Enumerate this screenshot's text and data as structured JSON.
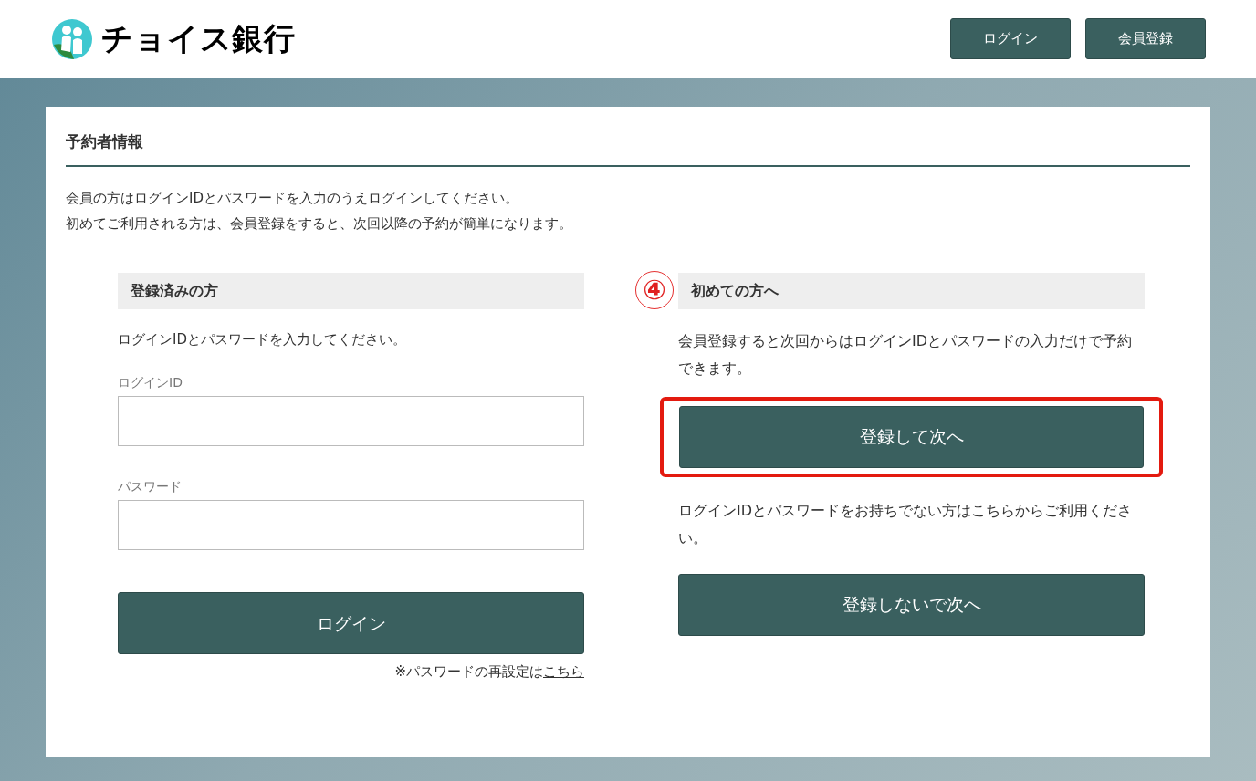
{
  "header": {
    "logo_text": "チョイス銀行",
    "buttons": [
      "ログイン",
      "会員登録"
    ]
  },
  "section": {
    "title": "予約者情報",
    "intro": [
      "会員の方はログインIDとパスワードを入力のうえログインしてください。",
      "初めてご利用される方は、会員登録をすると、次回以降の予約が簡単になります。"
    ]
  },
  "registered": {
    "title": "登録済みの方",
    "instruction": "ログインIDとパスワードを入力してください。",
    "fields": [
      {
        "label": "ログインID"
      },
      {
        "label": "パスワード"
      }
    ],
    "login_button": "ログイン",
    "reset_text": "※パスワードの再設定は",
    "reset_link": "こちら"
  },
  "new_user": {
    "step_mark": "④",
    "title": "初めての方へ",
    "description": "会員登録すると次回からはログインIDとパスワードの入力だけで予約できます。",
    "register_button": {
      "label": "登録して次へ",
      "highlighted": true
    },
    "guest_description": "ログインIDとパスワードをお持ちでない方はこちらからご利用ください。",
    "guest_button": "登録しないで次へ"
  }
}
